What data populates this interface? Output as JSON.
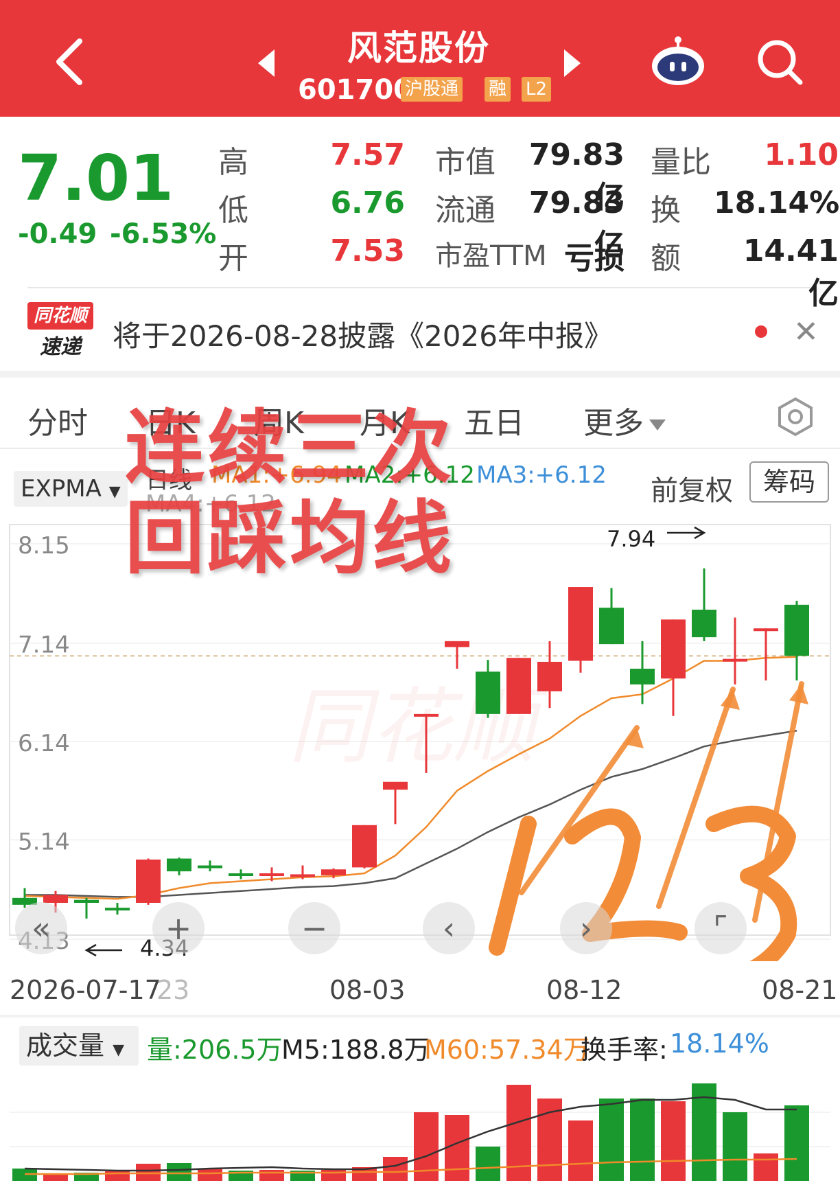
{
  "header": {
    "stock_name": "风范股份",
    "stock_code": "601700",
    "badges": [
      "沪股通",
      "融",
      "L2"
    ],
    "icons": [
      "back-arrow-icon",
      "prev-stock-icon",
      "next-stock-icon",
      "assistant-robot-icon",
      "search-icon"
    ]
  },
  "quote": {
    "price": "7.01",
    "change": "-0.49",
    "change_pct": "-6.53%",
    "high_label": "高",
    "high": "7.57",
    "low_label": "低",
    "low": "6.76",
    "open_label": "开",
    "open": "7.53",
    "mktcap_label": "市值",
    "mktcap": "79.83亿",
    "float_label": "流通",
    "float": "79.83亿",
    "pe_label": "市盈TTM",
    "pe": "亏损",
    "volratio_label": "量比",
    "volratio": "1.10",
    "turnover_label": "换",
    "turnover": "18.14%",
    "amount_label": "额",
    "amount": "14.41亿"
  },
  "notice": {
    "logo_top": "同花顺",
    "logo_bottom": "速递",
    "text": "将于2026-08-28披露《2026年中报》"
  },
  "tabs": {
    "items": [
      "分时",
      "日K",
      "周K",
      "月K",
      "五日",
      "更多"
    ]
  },
  "indicators": {
    "selector": "EXPMA",
    "period": "日线",
    "ma1": "MA1:+6.94",
    "ma2": "MA2:+6.12",
    "ma3": "MA3:+6.12",
    "ma4": "MA4:+6.12",
    "adjust": "前复权",
    "chip": "筹码",
    "colors": {
      "ma1": "#f08a2a",
      "ma2": "#1a9a2e",
      "ma3": "#3c8fd8",
      "up": "#e8373a",
      "down": "#1a9a2e"
    }
  },
  "chart_data": {
    "type": "candlestick",
    "y_ticks": [
      "8.15",
      "7.14",
      "6.14",
      "5.14",
      "4.13"
    ],
    "ylim": [
      4.13,
      8.15
    ],
    "x_ticks": [
      "2026-07-17",
      "23",
      "08-03",
      "08-12",
      "08-21"
    ],
    "annotations": [
      "7.94",
      "4.34"
    ],
    "watermark": "同花顺",
    "candles": [
      {
        "o": 4.55,
        "h": 4.65,
        "l": 4.45,
        "c": 4.48
      },
      {
        "o": 4.5,
        "h": 4.62,
        "l": 4.4,
        "c": 4.58
      },
      {
        "o": 4.53,
        "h": 4.55,
        "l": 4.34,
        "c": 4.5
      },
      {
        "o": 4.45,
        "h": 4.5,
        "l": 4.38,
        "c": 4.44
      },
      {
        "o": 4.5,
        "h": 4.95,
        "l": 4.48,
        "c": 4.94
      },
      {
        "o": 4.95,
        "h": 4.96,
        "l": 4.78,
        "c": 4.82
      },
      {
        "o": 4.88,
        "h": 4.93,
        "l": 4.82,
        "c": 4.87
      },
      {
        "o": 4.8,
        "h": 4.84,
        "l": 4.74,
        "c": 4.79
      },
      {
        "o": 4.8,
        "h": 4.86,
        "l": 4.72,
        "c": 4.8
      },
      {
        "o": 4.79,
        "h": 4.88,
        "l": 4.74,
        "c": 4.79
      },
      {
        "o": 4.78,
        "h": 4.85,
        "l": 4.75,
        "c": 4.84
      },
      {
        "o": 4.86,
        "h": 5.29,
        "l": 4.85,
        "c": 5.29
      },
      {
        "o": 5.65,
        "h": 5.7,
        "l": 5.3,
        "c": 5.73
      },
      {
        "o": 6.42,
        "h": 6.42,
        "l": 5.82,
        "c": 6.42
      },
      {
        "o": 7.1,
        "h": 7.15,
        "l": 6.88,
        "c": 7.16
      },
      {
        "o": 6.85,
        "h": 6.97,
        "l": 6.38,
        "c": 6.42
      },
      {
        "o": 6.42,
        "h": 6.99,
        "l": 6.42,
        "c": 6.99
      },
      {
        "o": 6.65,
        "h": 7.16,
        "l": 6.48,
        "c": 6.95
      },
      {
        "o": 6.96,
        "h": 7.71,
        "l": 6.84,
        "c": 7.71
      },
      {
        "o": 7.5,
        "h": 7.7,
        "l": 7.13,
        "c": 7.13
      },
      {
        "o": 6.88,
        "h": 7.16,
        "l": 6.52,
        "c": 6.72
      },
      {
        "o": 6.78,
        "h": 7.38,
        "l": 6.4,
        "c": 7.38
      },
      {
        "o": 7.48,
        "h": 7.9,
        "l": 7.16,
        "c": 7.2
      },
      {
        "o": 6.98,
        "h": 7.4,
        "l": 6.72,
        "c": 6.98
      },
      {
        "o": 7.28,
        "h": 7.29,
        "l": 6.76,
        "c": 7.29
      },
      {
        "o": 7.53,
        "h": 7.57,
        "l": 6.76,
        "c": 7.01
      }
    ],
    "ma1_values": [
      4.57,
      4.56,
      4.55,
      4.54,
      4.58,
      4.65,
      4.7,
      4.72,
      4.74,
      4.76,
      4.77,
      4.8,
      4.98,
      5.27,
      5.64,
      5.84,
      6.01,
      6.17,
      6.4,
      6.58,
      6.62,
      6.78,
      6.96,
      6.96,
      6.99,
      7.0
    ],
    "ma2_values": [
      4.58,
      4.58,
      4.57,
      4.56,
      4.56,
      4.58,
      4.6,
      4.62,
      4.64,
      4.66,
      4.67,
      4.7,
      4.75,
      4.9,
      5.05,
      5.22,
      5.37,
      5.5,
      5.65,
      5.78,
      5.86,
      5.97,
      6.09,
      6.15,
      6.2,
      6.25
    ]
  },
  "volume": {
    "selector": "成交量",
    "vol": "量:206.5万",
    "m5": "M5:188.8万",
    "m60": "M60:57.34万",
    "turnover_label": "换手率:",
    "turnover_value": "18.14%",
    "bars": [
      18,
      10,
      12,
      14,
      25,
      26,
      18,
      15,
      16,
      15,
      16,
      20,
      35,
      100,
      96,
      50,
      140,
      120,
      88,
      120,
      120,
      116,
      142,
      100,
      40,
      110
    ],
    "colors": [
      "down",
      "up",
      "down",
      "up",
      "up",
      "down",
      "up",
      "down",
      "up",
      "down",
      "up",
      "up",
      "up",
      "up",
      "up",
      "down",
      "up",
      "up",
      "up",
      "down",
      "down",
      "up",
      "down",
      "down",
      "up",
      "down"
    ],
    "m5_line": [
      18,
      17,
      16,
      15,
      15,
      16,
      18,
      19,
      20,
      18,
      17,
      17,
      22,
      36,
      55,
      72,
      86,
      100,
      108,
      112,
      118,
      118,
      122,
      118,
      104,
      104
    ],
    "m60_line": [
      10,
      10,
      10,
      11,
      11,
      11,
      11,
      12,
      12,
      12,
      12,
      13,
      13,
      15,
      17,
      19,
      21,
      23,
      25,
      27,
      28,
      29,
      30,
      31,
      31,
      32
    ]
  },
  "overlay": {
    "line1": "连续三次",
    "line2": "回踩均线",
    "handwriting": "123"
  },
  "chart_controls": [
    "rewind-icon",
    "zoom-in-icon",
    "zoom-out-icon",
    "prev-candle-icon",
    "next-candle-icon",
    "fullscreen-icon"
  ]
}
